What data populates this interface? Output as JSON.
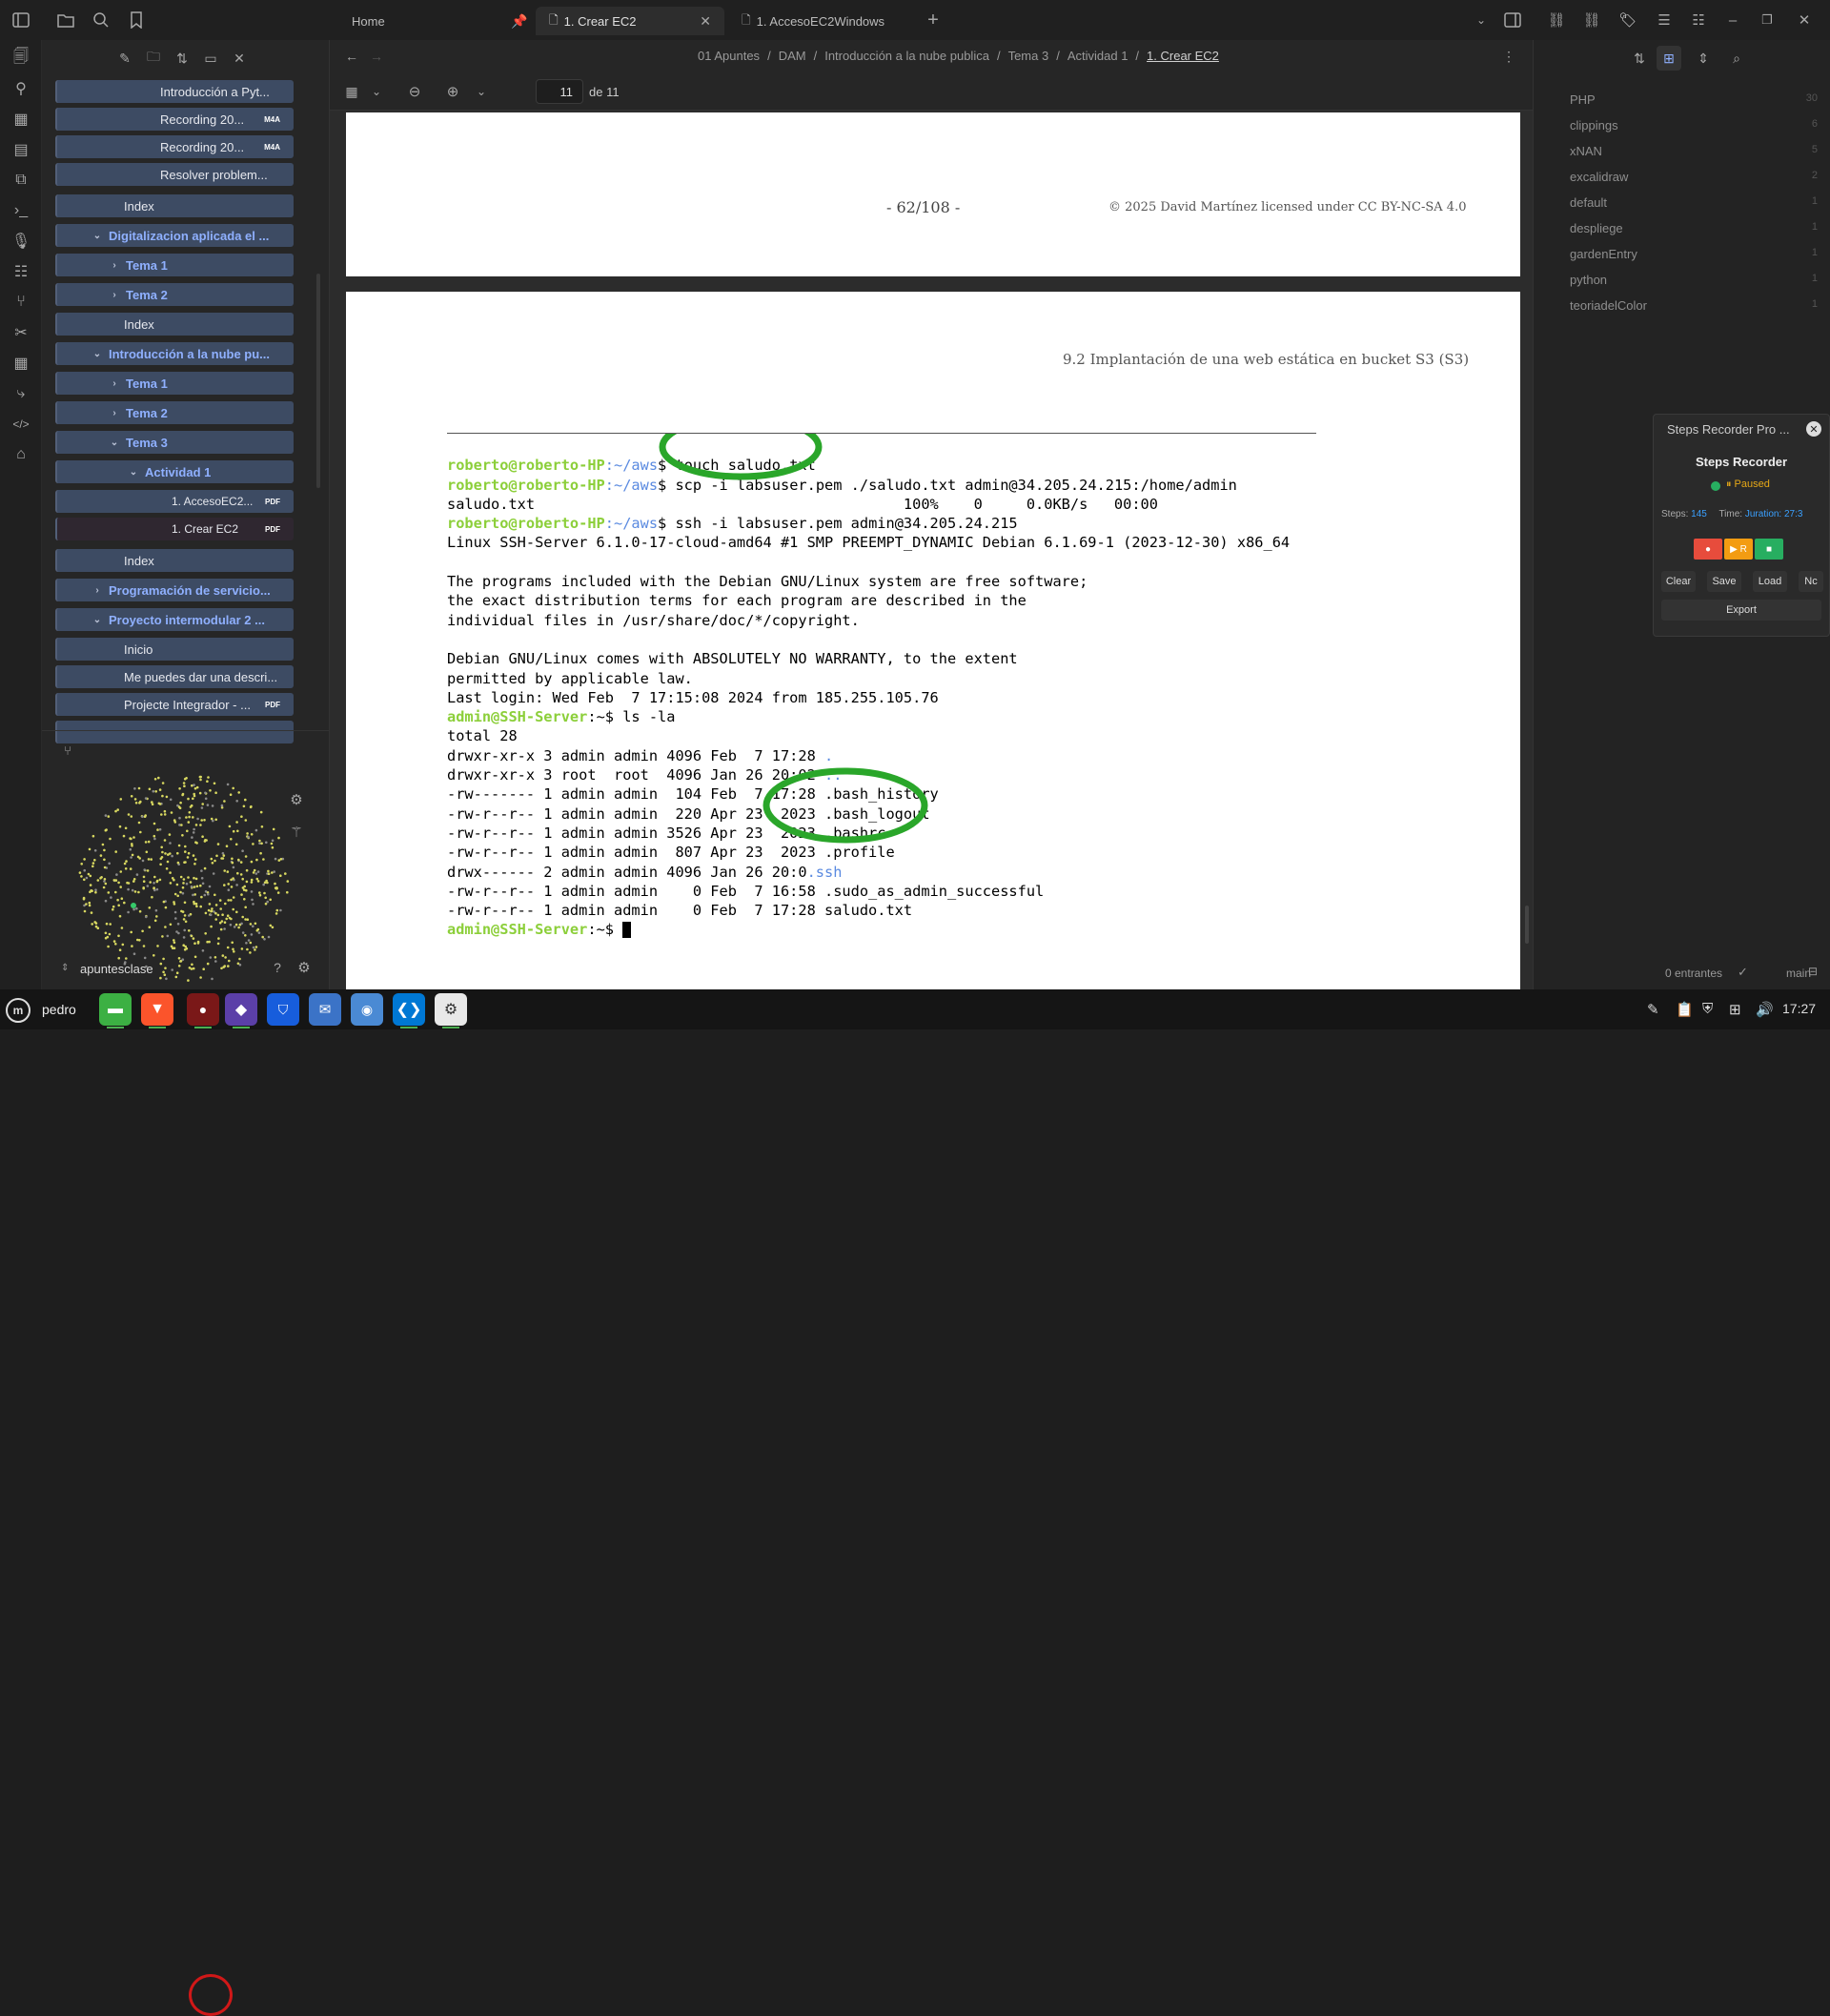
{
  "tabs": [
    {
      "label": "Home"
    },
    {
      "label": "1. Crear EC2"
    },
    {
      "label": "1. AccesoEC2Windows"
    }
  ],
  "breadcrumb": [
    "01 Apuntes",
    "DAM",
    "Introducción a la nube publica",
    "Tema 3",
    "Actividad 1",
    "1. Crear EC2"
  ],
  "pdf_toolbar": {
    "page_input": "11",
    "page_of": "de 11"
  },
  "sidebar": {
    "items": [
      {
        "label": "Introducción a Pyt...",
        "badge": ""
      },
      {
        "label": "Recording 20...",
        "badge": "M4A"
      },
      {
        "label": "Recording 20...",
        "badge": "M4A"
      },
      {
        "label": "Resolver problem...",
        "badge": ""
      },
      {
        "label": "Index",
        "badge": ""
      },
      {
        "label": "Digitalizacion aplicada el ...",
        "badge": ""
      },
      {
        "label": "Tema 1",
        "badge": ""
      },
      {
        "label": "Tema 2",
        "badge": ""
      },
      {
        "label": "Index",
        "badge": ""
      },
      {
        "label": "Introducción a la nube pu...",
        "badge": ""
      },
      {
        "label": "Tema 1",
        "badge": ""
      },
      {
        "label": "Tema 2",
        "badge": ""
      },
      {
        "label": "Tema 3",
        "badge": ""
      },
      {
        "label": "Actividad 1",
        "badge": ""
      },
      {
        "label": "1. AccesoEC2...",
        "badge": "PDF"
      },
      {
        "label": "1. Crear EC2",
        "badge": "PDF"
      },
      {
        "label": "Index",
        "badge": ""
      },
      {
        "label": "Programación de servicio...",
        "badge": ""
      },
      {
        "label": "Proyecto intermodular 2 ...",
        "badge": ""
      },
      {
        "label": "Inicio",
        "badge": ""
      },
      {
        "label": "Me puedes dar una descri...",
        "badge": ""
      },
      {
        "label": "Projecte Integrador - ...",
        "badge": "PDF"
      }
    ],
    "vault_name": "apuntesclase"
  },
  "pdf": {
    "page_number": "- 62/108 -",
    "license": "© 2025 David Martínez licensed under CC BY-NC-SA 4.0",
    "section_header": "9.2 Implantación de una web estática en bucket S3 (S3)"
  },
  "terminal": {
    "prompt_user": "roberto@roberto-HP",
    "prompt_path": ":~/aws",
    "admin_prompt": "admin@SSH-Server",
    "cmd1": "$ touch saludo.txt",
    "cmd2": "$ scp -i labsuser.pem ./saludo.txt admin@34.205.24.215:/home/admin",
    "scp_out": "saludo.txt                                          100%    0     0.0KB/s   00:00",
    "cmd3": "$ ssh -i labsuser.pem admin@34.205.24.215",
    "linux": "Linux SSH-Server 6.1.0-17-cloud-amd64 #1 SMP PREEMPT_DYNAMIC Debian 6.1.69-1 (2023-12-30) x86_64",
    "motd1": "The programs included with the Debian GNU/Linux system are free software;",
    "motd2": "the exact distribution terms for each program are described in the",
    "motd3": "individual files in /usr/share/doc/*/copyright.",
    "motd4": "Debian GNU/Linux comes with ABSOLUTELY NO WARRANTY, to the extent",
    "motd5": "permitted by applicable law.",
    "lastlogin": "Last login: Wed Feb  7 17:15:08 2024 from 185.255.105.76",
    "cmd4": ":~$ ls -la",
    "total": "total 28",
    "ls1a": "drwxr-xr-x 3 admin admin 4096 Feb  7 17:28 ",
    "ls1b": ".",
    "ls2a": "drwxr-xr-x 3 root  root  4096 Jan 26 20:02 ",
    "ls2b": "..",
    "ls3": "-rw------- 1 admin admin  104 Feb  7 17:28 .bash_history",
    "ls4": "-rw-r--r-- 1 admin admin  220 Apr 23  2023 .bash_logout",
    "ls5": "-rw-r--r-- 1 admin admin 3526 Apr 23  2023 .bashrc",
    "ls6": "-rw-r--r-- 1 admin admin  807 Apr 23  2023 .profile",
    "ls7a": "drwx------ 2 admin admin 4096 Jan 26 20:0",
    "ls7b": ".ssh",
    "ls8": "-rw-r--r-- 1 admin admin    0 Feb  7 16:58 .sudo_as_admin_successful",
    "ls9": "-rw-r--r-- 1 admin admin    0 Feb  7 17:28 saludo.txt",
    "cmd5": ":~$ "
  },
  "tags": [
    {
      "name": "PHP",
      "count": "30"
    },
    {
      "name": "clippings",
      "count": "6"
    },
    {
      "name": "xNAN",
      "count": "5"
    },
    {
      "name": "excalidraw",
      "count": "2"
    },
    {
      "name": "default",
      "count": "1"
    },
    {
      "name": "despliege",
      "count": "1"
    },
    {
      "name": "gardenEntry",
      "count": "1"
    },
    {
      "name": "python",
      "count": "1"
    },
    {
      "name": "teoriadelColor",
      "count": "1"
    }
  ],
  "steps_recorder": {
    "window_title": "Steps Recorder Pro ...",
    "title": "Steps Recorder",
    "status": "⏸ Paused",
    "steps_label": "Steps:",
    "steps_value": "145",
    "time_label": "Time:",
    "time_value": "Juration: 27:3",
    "rec_btn": "●",
    "resume_btn": "▶ R",
    "stop_btn": "■",
    "clear": "Clear",
    "save": "Save",
    "load": "Load",
    "more": "Nc",
    "export": "Export"
  },
  "statusbar": {
    "backlinks": "0 entrantes",
    "branch": "main"
  },
  "taskbar": {
    "user": "pedro",
    "clock": "17:27"
  },
  "colors": {
    "accent": "#8fb0ff",
    "highlight_circle": "#2aa62a",
    "tree_item": "#3d4b63"
  }
}
